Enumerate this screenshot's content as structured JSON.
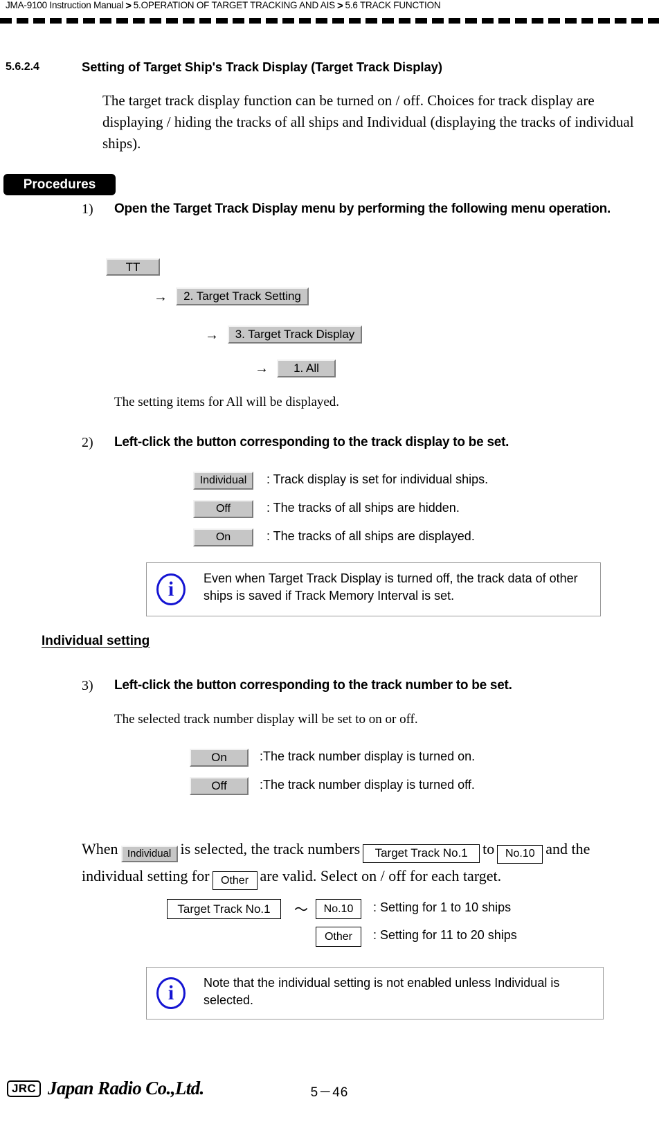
{
  "header": {
    "manual": "JMA-9100 Instruction Manual",
    "separator": ">",
    "chapter": "5.OPERATION OF TARGET TRACKING AND AIS",
    "section": "5.6  TRACK FUNCTION"
  },
  "section": {
    "number": "5.6.2.4",
    "title": "Setting of Target Ship's Track Display (Target Track Display)",
    "intro": "The target track display function can be turned on / off. Choices for track display are displaying / hiding the tracks of all ships and Individual (displaying the tracks of individual ships)."
  },
  "procedures": {
    "banner": "Procedures"
  },
  "step1": {
    "number": "1)",
    "text": "Open the Target Track Display menu by performing the following menu operation.",
    "menu_path": [
      {
        "label": "TT"
      },
      {
        "label": "2. Target Track Setting"
      },
      {
        "label": "3. Target Track Display"
      },
      {
        "label": "1. All"
      }
    ],
    "arrow": "→",
    "result": "The setting items for All will be displayed."
  },
  "step2": {
    "number": "2)",
    "text": "Left-click the button corresponding to the track display to be set.",
    "options": [
      {
        "button": "Individual",
        "description": ": Track display is set for individual ships."
      },
      {
        "button": "Off",
        "description": ": The tracks of all ships are hidden."
      },
      {
        "button": "On",
        "description": ": The tracks of all ships are displayed."
      }
    ]
  },
  "note1": {
    "icon": "i",
    "text": "Even when Target Track Display is turned off, the track data of other ships is saved if Track Memory Interval is set."
  },
  "individual_setting": {
    "heading": "Individual setting"
  },
  "step3": {
    "number": "3)",
    "text": "Left-click the button corresponding to the track number to be set.",
    "result": "The selected track number display will be set to on or off.",
    "options": [
      {
        "button": "On",
        "description": ":The track number display is turned on."
      },
      {
        "button": "Off",
        "description": ":The track number display is turned off."
      }
    ]
  },
  "when_paragraph": {
    "part1": "When",
    "button_individual": "Individual",
    "part2": "is selected, the track numbers",
    "box_first": "Target Track No.1",
    "part3": "to",
    "box_last": "No.10",
    "part4": "and the individual setting for",
    "box_other": "Other",
    "part5": "are valid. Select on / off for each target."
  },
  "range_rows": [
    {
      "box_from": "Target Track No.1",
      "tilde": "～",
      "box_to": "No.10",
      "description": ": Setting for 1 to 10 ships"
    },
    {
      "box": "Other",
      "description": ": Setting for 11 to 20 ships"
    }
  ],
  "note2": {
    "icon": "i",
    "text": "Note that the individual setting is not enabled unless  Individual is selected."
  },
  "footer": {
    "logo_mark": "JRC",
    "company": "Japan Radio Co.,Ltd.",
    "page": "5－46"
  }
}
